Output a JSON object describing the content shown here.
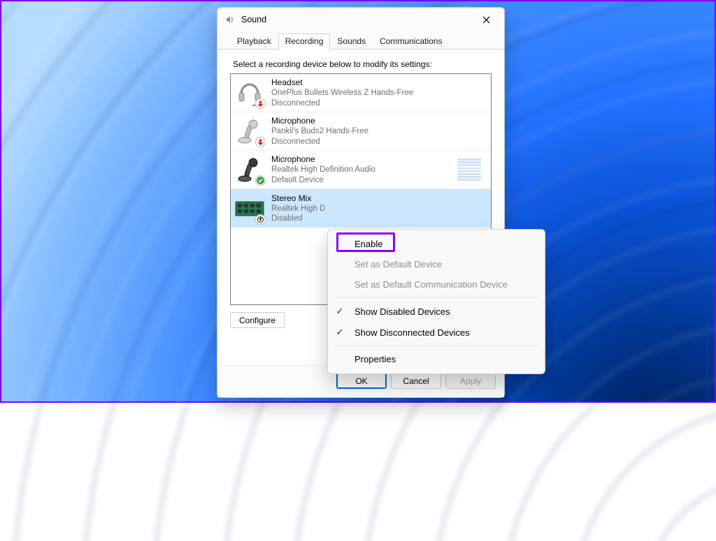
{
  "window": {
    "title": "Sound"
  },
  "tabs": {
    "playback": "Playback",
    "recording": "Recording",
    "sounds": "Sounds",
    "communications": "Communications",
    "active_index": 1
  },
  "instruction": "Select a recording device below to modify its settings:",
  "devices": [
    {
      "name": "Headset",
      "desc": "OnePlus Bullets Wireless Z Hands-Free",
      "status": "Disconnected",
      "icon": "headset",
      "badge": "disconnected"
    },
    {
      "name": "Microphone",
      "desc": "Pankil's Buds2 Hands-Free",
      "status": "Disconnected",
      "icon": "mic",
      "badge": "disconnected"
    },
    {
      "name": "Microphone",
      "desc": "Realtek High Definition Audio",
      "status": "Default Device",
      "icon": "mic",
      "badge": "default",
      "meter": true
    },
    {
      "name": "Stereo Mix",
      "desc": "Realtek High Definition Audio",
      "status": "Disabled",
      "icon": "board",
      "badge": "disabled",
      "selected": true,
      "desc_truncated": "Realtek High D"
    }
  ],
  "buttons": {
    "configure": "Configure",
    "ok": "OK",
    "cancel": "Cancel",
    "apply": "Apply"
  },
  "context_menu": {
    "enable": "Enable",
    "set_default": "Set as Default Device",
    "set_default_comm": "Set as Default Communication Device",
    "show_disabled": "Show Disabled Devices",
    "show_disconnected": "Show Disconnected Devices",
    "properties": "Properties"
  }
}
